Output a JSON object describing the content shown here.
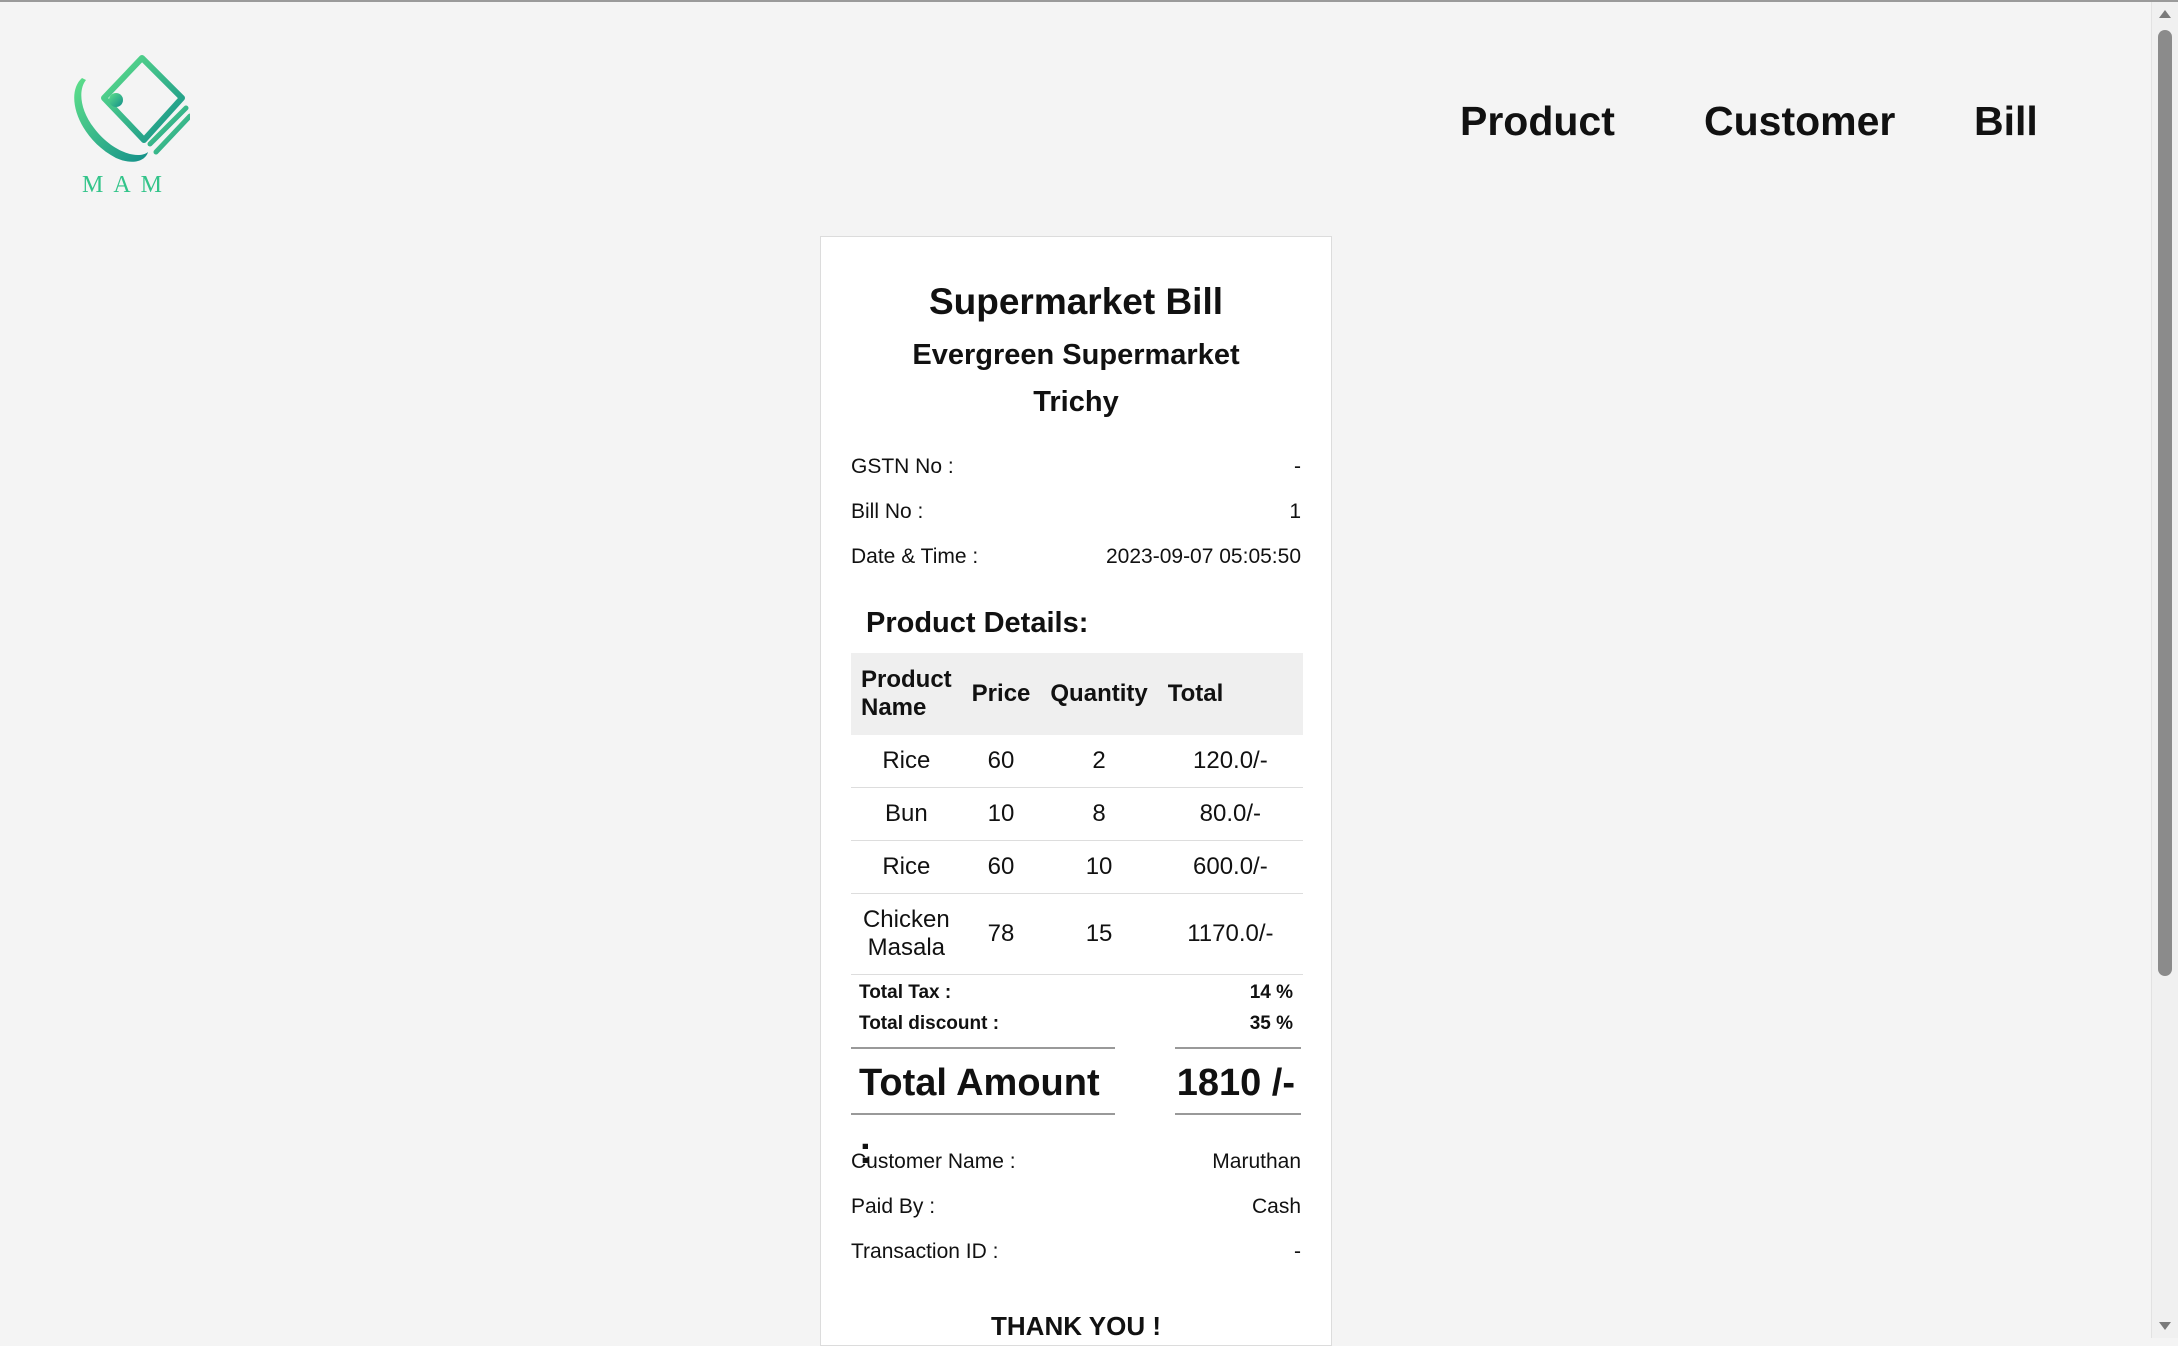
{
  "header": {
    "logo_text": "MAM",
    "nav": {
      "product": "Product",
      "customer": "Customer",
      "bill": "Bill"
    }
  },
  "bill": {
    "title": "Supermarket Bill",
    "store": "Evergreen Supermarket",
    "city": "Trichy",
    "gstn_label": "GSTN No :",
    "gstn_value": "-",
    "bill_no_label": "Bill No :",
    "bill_no_value": "1",
    "datetime_label": "Date & Time :",
    "datetime_value": "2023-09-07 05:05:50",
    "product_details_heading": "Product Details:",
    "columns": {
      "name": "Product Name",
      "price": "Price",
      "quantity": "Quantity",
      "total": "Total"
    },
    "items": [
      {
        "name": "Rice",
        "price": "60",
        "quantity": "2",
        "total": "120.0/-"
      },
      {
        "name": "Bun",
        "price": "10",
        "quantity": "8",
        "total": "80.0/-"
      },
      {
        "name": "Rice",
        "price": "60",
        "quantity": "10",
        "total": "600.0/-"
      },
      {
        "name": "Chicken Masala",
        "price": "78",
        "quantity": "15",
        "total": "1170.0/-"
      }
    ],
    "total_tax_label": "Total Tax :",
    "total_tax_value": "14 %",
    "total_discount_label": "Total discount :",
    "total_discount_value": "35 %",
    "total_amount_label": "Total Amount :",
    "total_amount_value": "1810 /-",
    "customer_name_label": "Customer Name :",
    "customer_name_value": "Maruthan",
    "paid_by_label": "Paid By :",
    "paid_by_value": "Cash",
    "transaction_label": "Transaction ID :",
    "transaction_value": "-",
    "thanks": "THANK YOU !"
  },
  "colors": {
    "background": "#f4f4f4",
    "logo_green": "#33c48a",
    "logo_teal": "#1a9e8f"
  }
}
